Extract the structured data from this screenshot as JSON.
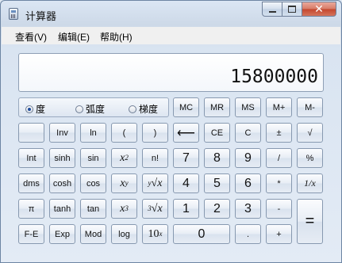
{
  "window": {
    "title": "计算器"
  },
  "menu": [
    {
      "label": "查看(V)"
    },
    {
      "label": "编辑(E)"
    },
    {
      "label": "帮助(H)"
    }
  ],
  "display": {
    "value": "15800000"
  },
  "angle_modes": [
    {
      "label": "度",
      "selected": true
    },
    {
      "label": "弧度",
      "selected": false
    },
    {
      "label": "梯度",
      "selected": false
    }
  ],
  "memory_buttons": [
    "MC",
    "MR",
    "MS",
    "M+",
    "M-"
  ],
  "keys": {
    "inv": "Inv",
    "ln": "ln",
    "lparen": "(",
    "rparen": ")",
    "backspace": "⟵",
    "ce": "CE",
    "c": "C",
    "plusminus": "±",
    "sqrt": "√",
    "int": "Int",
    "sinh": "sinh",
    "sin": "sin",
    "square_base": "x",
    "square_exp": "2",
    "factorial": "n!",
    "seven": "7",
    "eight": "8",
    "nine": "9",
    "divide": "/",
    "percent": "%",
    "dms": "dms",
    "cosh": "cosh",
    "cos": "cos",
    "pow_base": "x",
    "pow_exp": "y",
    "yroot_idx": "y",
    "yroot": "√x",
    "four": "4",
    "five": "5",
    "six": "6",
    "multiply": "*",
    "reciprocal": "1/x",
    "pi": "π",
    "tanh": "tanh",
    "tan": "tan",
    "cube_base": "x",
    "cube_exp": "3",
    "cbrt_idx": "3",
    "cbrt": "√x",
    "one": "1",
    "two": "2",
    "three": "3",
    "minus": "-",
    "equals": "=",
    "fe": "F-E",
    "exp": "Exp",
    "mod": "Mod",
    "log": "log",
    "ten_base": "10",
    "ten_exp": "x",
    "zero": "0",
    "dot": ".",
    "plus": "+"
  }
}
